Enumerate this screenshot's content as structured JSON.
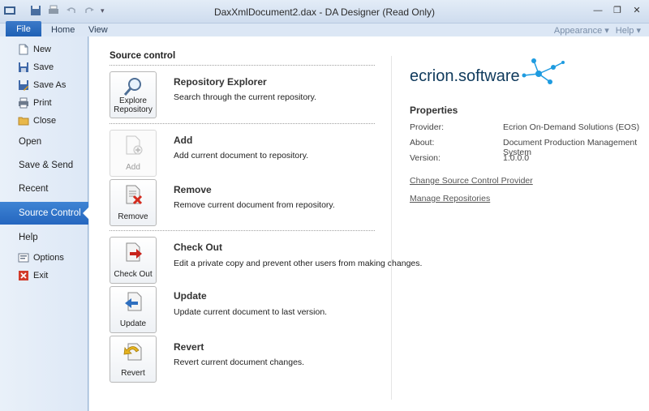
{
  "window": {
    "title": "DaxXmlDocument2.dax - DA Designer (Read Only)"
  },
  "ribbon": {
    "file_tab": "File",
    "tabs": [
      "Home",
      "View"
    ],
    "appearance": "Appearance",
    "help": "Help"
  },
  "backstage": {
    "commands_top": [
      {
        "label": "New",
        "icon": "new-document-icon"
      },
      {
        "label": "Save",
        "icon": "save-icon"
      },
      {
        "label": "Save As",
        "icon": "save-as-icon"
      },
      {
        "label": "Print",
        "icon": "print-icon"
      },
      {
        "label": "Close",
        "icon": "folder-close-icon"
      }
    ],
    "nav": [
      "Open",
      "Save & Send",
      "Recent",
      "Source Control",
      "Help"
    ],
    "active_nav": "Source Control",
    "commands_bottom": [
      {
        "label": "Options",
        "icon": "options-icon"
      },
      {
        "label": "Exit",
        "icon": "exit-icon"
      }
    ]
  },
  "source_control": {
    "title": "Source control",
    "actions": [
      {
        "button": "Explore Repository",
        "title": "Repository Explorer",
        "desc": "Search through the current repository.",
        "enabled": true
      },
      {
        "button": "Add",
        "title": "Add",
        "desc": "Add current document to repository.",
        "enabled": false
      },
      {
        "button": "Remove",
        "title": "Remove",
        "desc": "Remove current document from repository.",
        "enabled": true
      },
      {
        "button": "Check Out",
        "title": "Check Out",
        "desc": "Edit a private copy and prevent other users from making changes.",
        "enabled": true
      },
      {
        "button": "Update",
        "title": "Update",
        "desc": "Update current document to last version.",
        "enabled": true
      },
      {
        "button": "Revert",
        "title": "Revert",
        "desc": "Revert current document changes.",
        "enabled": true
      }
    ]
  },
  "provider": {
    "logo_main": "ecrion",
    "logo_dot": ".",
    "logo_suffix": "software",
    "properties_title": "Properties",
    "properties": [
      {
        "key": "Provider:",
        "value": "Ecrion On-Demand Solutions (EOS)"
      },
      {
        "key": "About:",
        "value": "Document Production Management System"
      },
      {
        "key": "Version:",
        "value": "1.0.0.0"
      }
    ],
    "links": [
      "Change Source Control Provider",
      "Manage Repositories"
    ]
  },
  "colors": {
    "accent": "#2566bf",
    "logo_blue": "#1e9be0"
  }
}
